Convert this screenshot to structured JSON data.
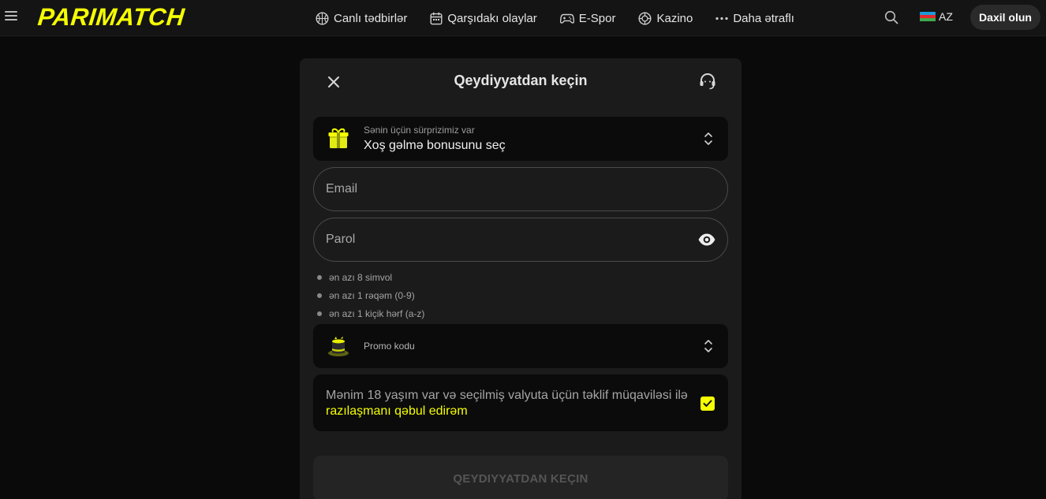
{
  "header": {
    "logo": "PARIMATCH",
    "nav": [
      {
        "label": "Canlı tədbirlər",
        "icon": "live-ball-icon"
      },
      {
        "label": "Qarşıdakı olaylar",
        "icon": "calendar-icon"
      },
      {
        "label": "E-Spor",
        "icon": "gamepad-icon"
      },
      {
        "label": "Kazino",
        "icon": "casino-chip-icon"
      },
      {
        "label": "Daha ətraflı",
        "icon": "more-dots-icon"
      }
    ],
    "language": "AZ",
    "login_label": "Daxil olun",
    "accent_color": "#f5ff00"
  },
  "modal": {
    "title": "Qeydiyyatdan keçin",
    "bonus": {
      "subtitle": "Sənin üçün sürprizimiz var",
      "value": "Xoş gəlmə bonusunu seç"
    },
    "email": {
      "placeholder": "Email",
      "value": ""
    },
    "password": {
      "placeholder": "Parol",
      "value": ""
    },
    "password_rules": [
      "ən azı 8 simvol",
      "ən azı 1 rəqəm (0-9)",
      "ən azı 1 kiçik hərf (a-z)"
    ],
    "promo": {
      "label": "Promo kodu"
    },
    "agreement": {
      "text": "Mənim 18 yaşım var və seçilmiş valyuta üçün təklif müqaviləsi ilə ",
      "link": "razılaşmanı qəbul edirəm",
      "checked": true
    },
    "submit_label": "QEYDIYYATDAN KEÇIN"
  }
}
